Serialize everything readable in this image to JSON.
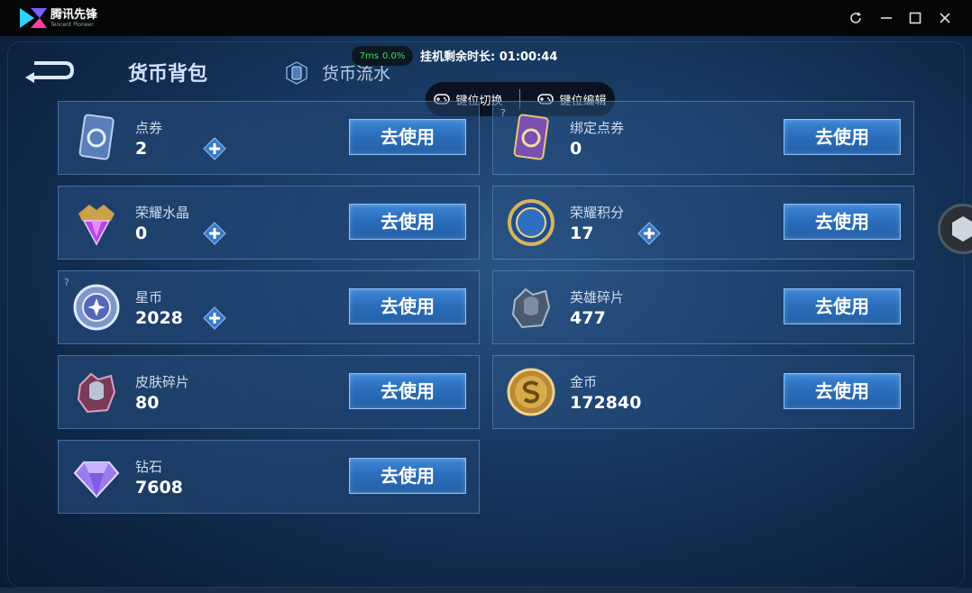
{
  "window": {
    "app_name": "腾讯先锋",
    "app_subtitle": "Tencent Pioneer"
  },
  "header": {
    "tab_bag": "货币背包",
    "tab_flow": "货币流水",
    "net_latency": "7ms",
    "net_loss": "0.0%",
    "session_timer": "挂机剩余时长: 01:00:44"
  },
  "keybar": {
    "switch_label": "键位切换",
    "edit_label": "键位编辑"
  },
  "use_label": "去使用",
  "currencies": [
    {
      "name": "点券",
      "amount": "2"
    },
    {
      "name": "绑定点券",
      "amount": "0"
    },
    {
      "name": "荣耀水晶",
      "amount": "0"
    },
    {
      "name": "荣耀积分",
      "amount": "17"
    },
    {
      "name": "星币",
      "amount": "2028"
    },
    {
      "name": "英雄碎片",
      "amount": "477"
    },
    {
      "name": "皮肤碎片",
      "amount": "80"
    },
    {
      "name": "金币",
      "amount": "172840"
    },
    {
      "name": "钻石",
      "amount": "7608"
    }
  ],
  "help_mark": "?",
  "icons": {
    "coupon": "coupon-card-icon",
    "bound_coupon": "bound-coupon-card-icon",
    "crystal": "honor-crystal-icon",
    "honor_points": "honor-points-icon",
    "star_coin": "star-coin-icon",
    "hero_fragment": "hero-fragment-icon",
    "skin_fragment": "skin-fragment-icon",
    "gold": "gold-coin-icon",
    "diamond": "diamond-icon"
  },
  "colors": {
    "accent_button": "#2f74c4",
    "latency_green": "#36e05a"
  }
}
